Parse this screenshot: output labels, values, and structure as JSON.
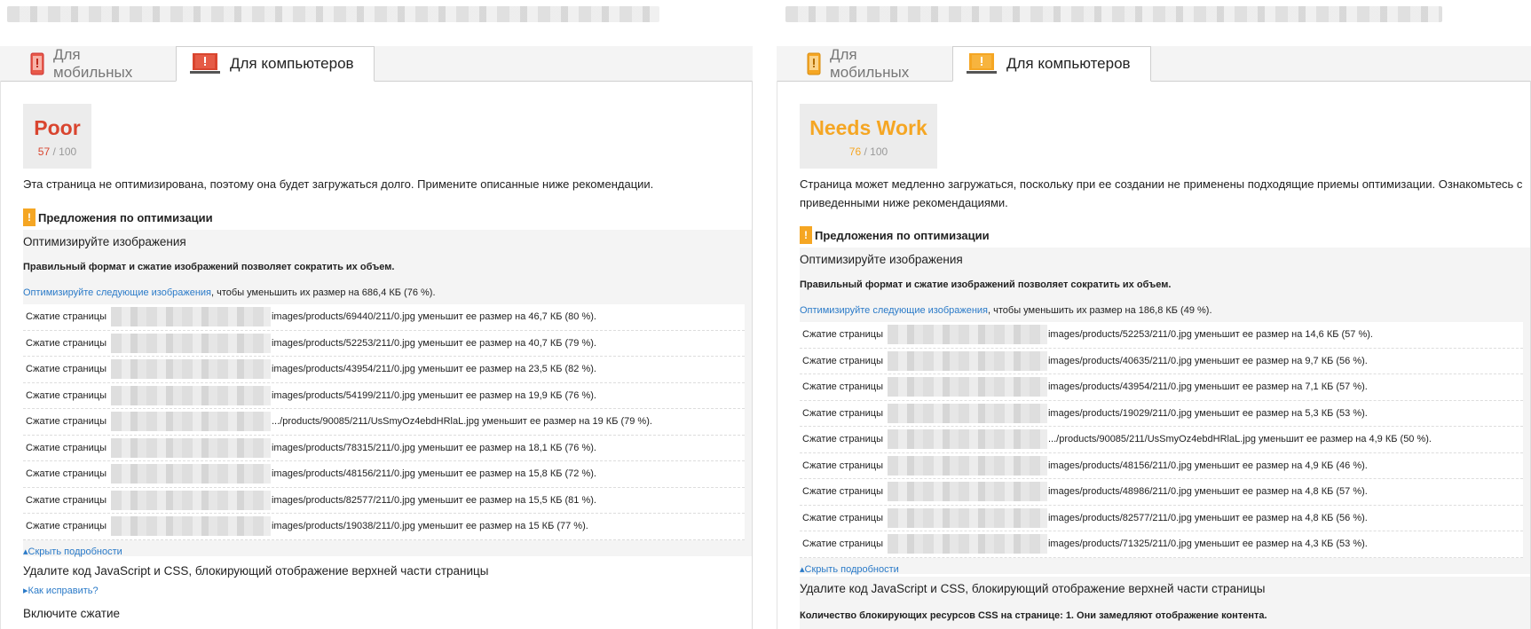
{
  "left": {
    "tabs": [
      {
        "label": "Для мобильных",
        "active": false
      },
      {
        "label": "Для компьютеров",
        "active": true
      }
    ],
    "score": {
      "label": "Poor",
      "value": "57",
      "max": " / 100",
      "color": "#d9452f"
    },
    "summary": "Эта страница не оптимизирована, поэтому она будет загружаться долго. Примените описанные ниже рекомендации.",
    "section_title": "Предложения по оптимизации",
    "rule_title": "Оптимизируйте изображения",
    "rule_desc": "Правильный формат и сжатие изображений позволяет сократить их объем.",
    "rule_link": "Оптимизируйте следующие изображения",
    "rule_link_rest": ", чтобы уменьшить их размер на 686,4 КБ (76 %).",
    "row_prefix": "Сжатие страницы",
    "rows": [
      "images/products/69440/211/0.jpg уменьшит ее размер на 46,7 КБ (80 %).",
      "images/products/52253/211/0.jpg уменьшит ее размер на 40,7 КБ (79 %).",
      "images/products/43954/211/0.jpg уменьшит ее размер на 23,5 КБ (82 %).",
      "images/products/54199/211/0.jpg уменьшит ее размер на 19,9 КБ (76 %).",
      ".../products/90085/211/UsSmyOz4ebdHRlaL.jpg уменьшит ее размер на 19 КБ (79 %).",
      "images/products/78315/211/0.jpg уменьшит ее размер на 18,1 КБ (76 %).",
      "images/products/48156/211/0.jpg уменьшит ее размер на 15,8 КБ (72 %).",
      "images/products/82577/211/0.jpg уменьшит ее размер на 15,5 КБ (81 %).",
      "images/products/19038/211/0.jpg уменьшит ее размер на 15 КБ (77 %)."
    ],
    "toggle": "Скрыть подробности",
    "rule2_title": "Удалите код JavaScript и CSS, блокирующий отображение верхней части страницы",
    "rule2_link": "Как исправить?",
    "rule3_title": "Включите сжатие"
  },
  "right": {
    "tabs": [
      {
        "label": "Для мобильных",
        "active": false
      },
      {
        "label": "Для компьютеров",
        "active": true
      }
    ],
    "score": {
      "label": "Needs Work",
      "value": "76",
      "max": " / 100",
      "color": "#f5a623"
    },
    "summary": "Страница может медленно загружаться, поскольку при ее создании не применены подходящие приемы оптимизации. Ознакомьтесь с приведенными ниже рекомендациями.",
    "section_title": "Предложения по оптимизации",
    "rule_title": "Оптимизируйте изображения",
    "rule_desc": "Правильный формат и сжатие изображений позволяет сократить их объем.",
    "rule_link": "Оптимизируйте следующие изображения",
    "rule_link_rest": ", чтобы уменьшить их размер на 186,8 КБ (49 %).",
    "row_prefix": "Сжатие страницы",
    "rows": [
      "images/products/52253/211/0.jpg уменьшит ее размер на 14,6 КБ (57 %).",
      "images/products/40635/211/0.jpg уменьшит ее размер на 9,7 КБ (56 %).",
      "images/products/43954/211/0.jpg уменьшит ее размер на 7,1 КБ (57 %).",
      "images/products/19029/211/0.jpg уменьшит ее размер на 5,3 КБ (53 %).",
      ".../products/90085/211/UsSmyOz4ebdHRlaL.jpg уменьшит ее размер на 4,9 КБ (50 %).",
      "images/products/48156/211/0.jpg уменьшит ее размер на 4,9 КБ (46 %).",
      "images/products/48986/211/0.jpg уменьшит ее размер на 4,8 КБ (57 %).",
      "images/products/82577/211/0.jpg уменьшит ее размер на 4,8 КБ (56 %).",
      "images/products/71325/211/0.jpg уменьшит ее размер на 4,3 КБ (53 %)."
    ],
    "toggle": "Скрыть подробности",
    "rule2_title": "Удалите код JavaScript и CSS, блокирующий отображение верхней части страницы",
    "rule2_desc": "Количество блокирующих ресурсов CSS на странице: 1. Они замедляют отображение контента."
  }
}
